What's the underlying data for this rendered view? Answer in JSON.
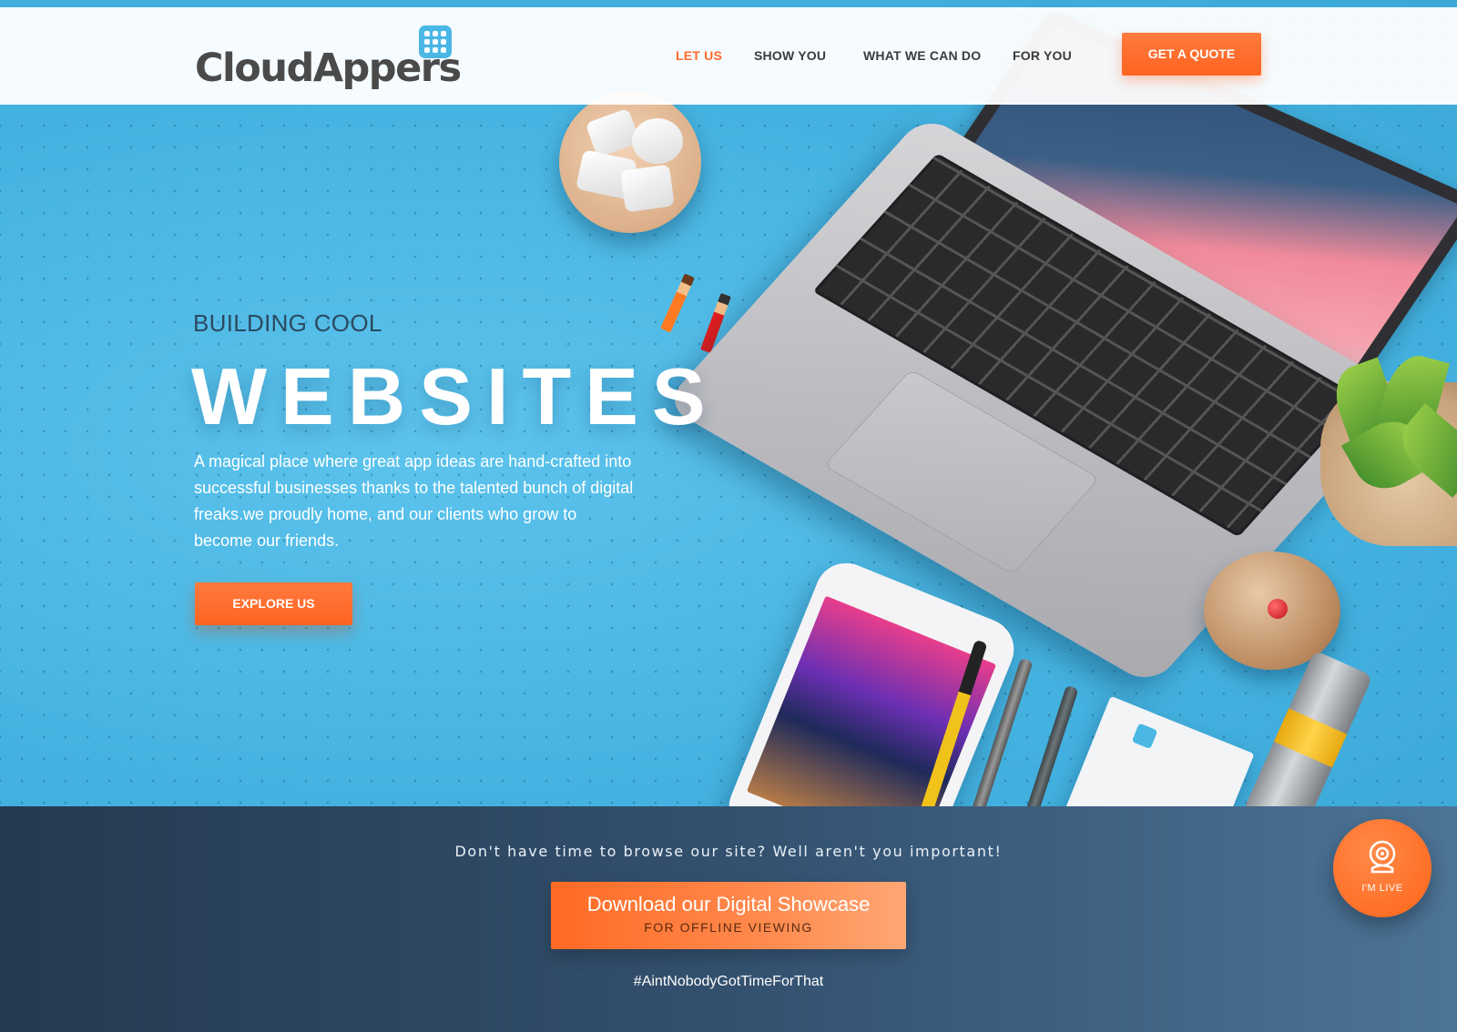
{
  "header": {
    "logo_text": "CloudAppers",
    "nav": [
      {
        "label": "LET US",
        "active": true
      },
      {
        "label": "SHOW YOU",
        "active": false
      },
      {
        "label": "WHAT WE CAN DO",
        "active": false
      },
      {
        "label": "FOR YOU",
        "active": false
      }
    ],
    "cta_label": "GET A QUOTE"
  },
  "hero": {
    "eyebrow": "BUILDING COOL",
    "headline": "WEBSITES",
    "body": "A magical place where great app ideas are hand-crafted into successful businesses thanks to the talented bunch of digital freaks.we proudly home, and our clients who grow to become our friends.",
    "button_label": "EXPLORE US"
  },
  "band": {
    "lead": "Don't have time to browse our site? Well aren't you important!",
    "download_main": "Download our Digital Showcase",
    "download_sub": "FOR OFFLINE VIEWING",
    "hashtag": "#AintNobodyGotTimeForThat"
  },
  "live_chat": {
    "label": "I'M LIVE",
    "icon": "webcam-icon"
  },
  "colors": {
    "accent": "#ff6a2b",
    "hero_bg": "#4fb9e4",
    "band_dark": "#253a50",
    "band_light": "#4c7497",
    "logo_blue": "#4ab7e5"
  }
}
